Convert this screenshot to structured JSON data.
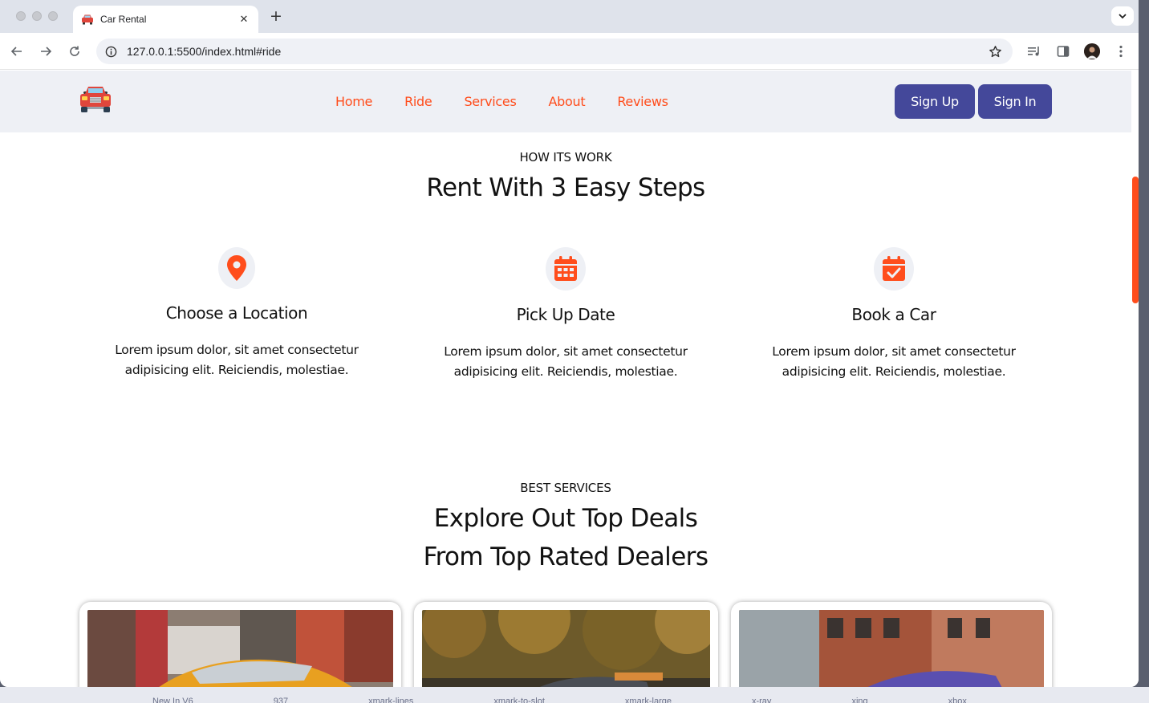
{
  "browser": {
    "tab_title": "Car Rental",
    "tab_close": "✕",
    "new_tab": "+",
    "url": "127.0.0.1:5500/index.html#ride"
  },
  "site": {
    "nav": [
      "Home",
      "Ride",
      "Services",
      "About",
      "Reviews"
    ],
    "signup_label": "Sign Up",
    "signin_label": "Sign In",
    "accent_color": "#ff4d1c",
    "button_color": "#44489a"
  },
  "how_it_works": {
    "subtitle": "HOW ITS WORK",
    "title": "Rent With 3 Easy Steps",
    "steps": [
      {
        "icon": "location-pin-icon",
        "title": "Choose a Location",
        "line1": "Lorem ipsum dolor, sit amet consectetur",
        "line2": "adipisicing elit. Reiciendis, molestiae."
      },
      {
        "icon": "calendar-icon",
        "title": "Pick Up Date",
        "line1": "Lorem ipsum dolor, sit amet consectetur",
        "line2": "adipisicing elit. Reiciendis, molestiae."
      },
      {
        "icon": "calendar-check-icon",
        "title": "Book a Car",
        "line1": "Lorem ipsum dolor, sit amet consectetur",
        "line2": "adipisicing elit. Reiciendis, molestiae."
      }
    ]
  },
  "services": {
    "subtitle": "BEST SERVICES",
    "title_line1": "Explore Out Top Deals",
    "title_line2": "From Top Rated Dealers"
  },
  "taskbar": [
    "New In V6",
    "937",
    "xmark-lines",
    "xmark-to-slot",
    "xmark-large",
    "x-ray",
    "xing",
    "xbox"
  ]
}
